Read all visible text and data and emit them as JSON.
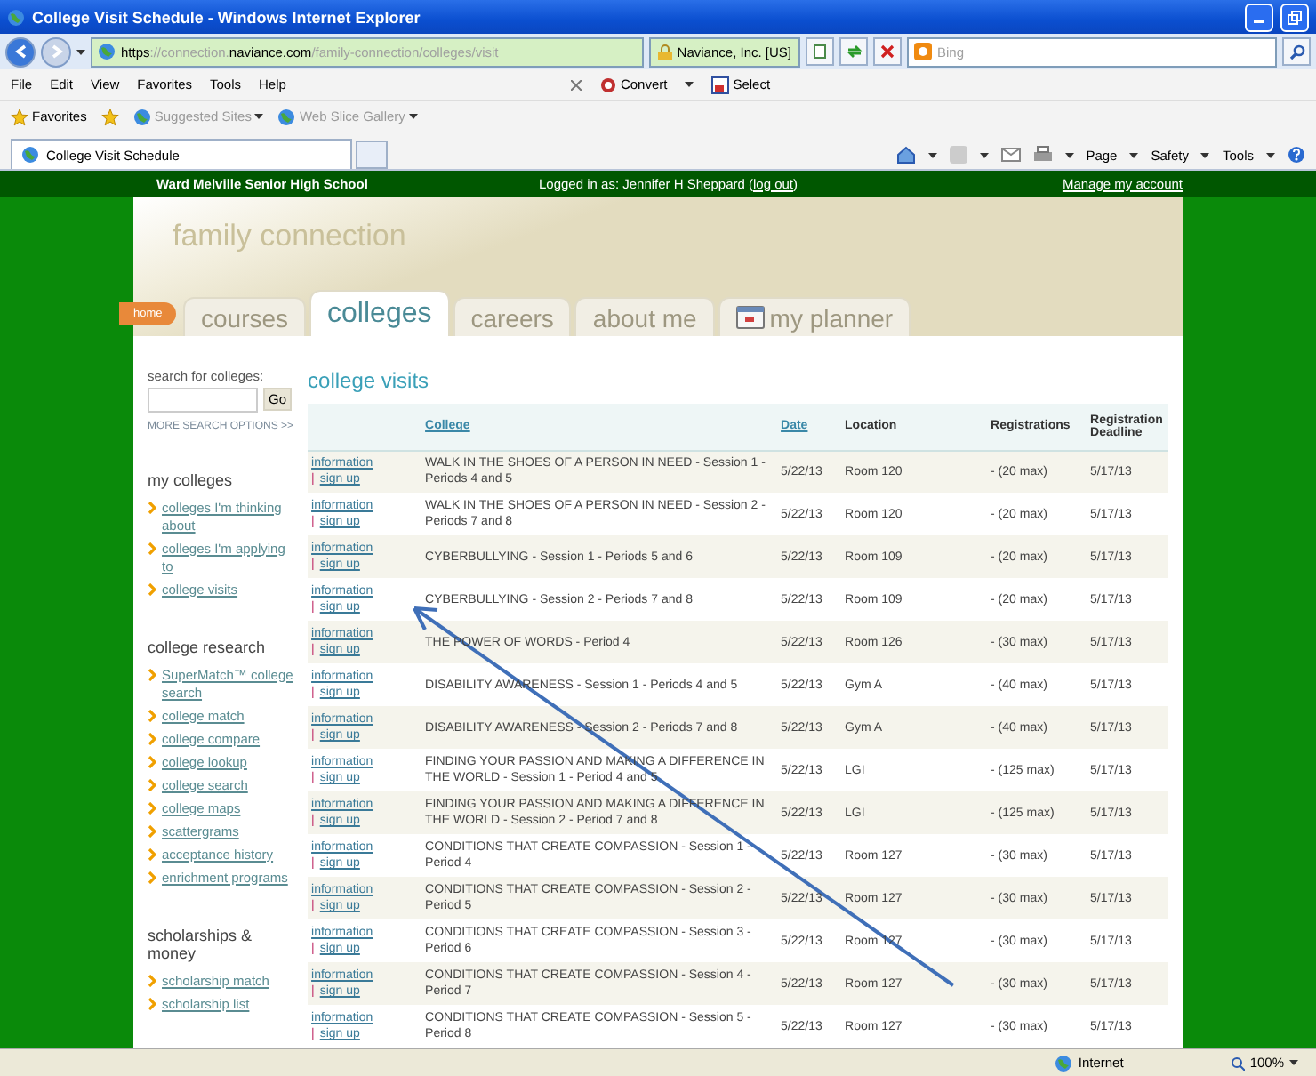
{
  "browser": {
    "title": "College Visit Schedule - Windows Internet Explorer",
    "address": {
      "scheme": "https",
      "sep": "://",
      "host_pre": "connection.",
      "host": "naviance.com",
      "path": "/family-connection/colleges/visit"
    },
    "security": "Naviance, Inc. [US]",
    "search": {
      "placeholder": "Bing"
    },
    "menu": [
      "File",
      "Edit",
      "View",
      "Favorites",
      "Tools",
      "Help"
    ],
    "toolbar": [
      "Convert",
      "Select"
    ],
    "favorites": {
      "label": "Favorites",
      "links": [
        {
          "label": "Suggested Sites",
          "disabled": true
        },
        {
          "label": "Web Slice Gallery",
          "disabled": true
        }
      ]
    },
    "tabs": [
      {
        "label": "College Visit Schedule",
        "selected": true
      }
    ],
    "commands": [
      "Page",
      "Safety",
      "Tools"
    ],
    "status": "Internet",
    "zoom": "100%"
  },
  "site": {
    "school": "Ward Melville Senior High School",
    "login": "Logged in as: Jennifer H Sheppard (",
    "logout": "log out",
    "login_end": ")",
    "manage": "Manage my account",
    "brand": "family connection",
    "home": "home",
    "tabs": [
      {
        "label": "courses",
        "selected": false,
        "kind": "text"
      },
      {
        "label": "colleges",
        "selected": true,
        "kind": "text"
      },
      {
        "label": "careers",
        "selected": false,
        "kind": "text"
      },
      {
        "label": "about me",
        "selected": false,
        "kind": "text"
      },
      {
        "label": "my planner",
        "selected": false,
        "kind": "planner"
      }
    ],
    "search": {
      "label": "search for colleges:",
      "button": "Go",
      "more": "MORE SEARCH OPTIONS >>"
    },
    "sections": [
      {
        "title": "my colleges",
        "links": [
          "colleges I'm thinking about",
          "colleges I'm applying to",
          "college visits"
        ]
      },
      {
        "title": "college research",
        "links": [
          "SuperMatch™ college search",
          "college match",
          "college compare",
          "college lookup",
          "college search",
          "college maps",
          "scattergrams",
          "acceptance history",
          "enrichment programs"
        ]
      },
      {
        "title": "scholarships & money",
        "links": [
          "scholarship match",
          "scholarship list"
        ]
      }
    ],
    "page_title": "college visits",
    "columns": [
      {
        "label": "College",
        "link": true
      },
      {
        "label": "Date",
        "link": true
      },
      {
        "label": "Location",
        "link": false
      },
      {
        "label": "Registrations",
        "link": false
      },
      {
        "label": "Registration Deadline",
        "link": false
      }
    ],
    "rows": [
      {
        "info": "information",
        "separator": "|",
        "signup": "sign up",
        "college": "WALK IN THE SHOES OF A PERSON IN NEED - Session 1 - Periods 4 and 5",
        "date": "5/22/13",
        "location": "Room 120",
        "registrations": "- (20 max)",
        "deadline": "5/17/13"
      },
      {
        "info": "information",
        "separator": "|",
        "signup": "sign up",
        "college": "WALK IN THE SHOES OF A PERSON IN NEED - Session 2 - Periods 7 and 8",
        "date": "5/22/13",
        "location": "Room 120",
        "registrations": "- (20 max)",
        "deadline": "5/17/13"
      },
      {
        "info": "information",
        "separator": "|",
        "signup": "sign up",
        "college": "CYBERBULLYING - Session 1 - Periods 5 and 6",
        "date": "5/22/13",
        "location": "Room 109",
        "registrations": "- (20 max)",
        "deadline": "5/17/13"
      },
      {
        "info": "information",
        "separator": "|",
        "signup": "sign up",
        "college": "CYBERBULLYING - Session 2 - Periods 7 and 8",
        "date": "5/22/13",
        "location": "Room 109",
        "registrations": "- (20 max)",
        "deadline": "5/17/13"
      },
      {
        "info": "information",
        "separator": "|",
        "signup": "sign up",
        "college": "THE POWER OF WORDS - Period 4",
        "date": "5/22/13",
        "location": "Room 126",
        "registrations": "- (30 max)",
        "deadline": "5/17/13"
      },
      {
        "info": "information",
        "separator": "|",
        "signup": "sign up",
        "college": "DISABILITY AWARENESS - Session 1 - Periods 4 and 5",
        "date": "5/22/13",
        "location": "Gym A",
        "registrations": "- (40 max)",
        "deadline": "5/17/13"
      },
      {
        "info": "information",
        "separator": "|",
        "signup": "sign up",
        "college": "DISABILITY AWARENESS - Session 2 - Periods 7 and 8",
        "date": "5/22/13",
        "location": "Gym A",
        "registrations": "- (40 max)",
        "deadline": "5/17/13"
      },
      {
        "info": "information",
        "separator": "|",
        "signup": "sign up",
        "college": "FINDING YOUR PASSION AND MAKING A DIFFERENCE IN THE WORLD - Session 1 - Period 4 and 5",
        "date": "5/22/13",
        "location": "LGI",
        "registrations": "- (125 max)",
        "deadline": "5/17/13"
      },
      {
        "info": "information",
        "separator": "|",
        "signup": "sign up",
        "college": "FINDING YOUR PASSION AND MAKING A DIFFERENCE IN THE WORLD - Session 2 - Period 7 and 8",
        "date": "5/22/13",
        "location": "LGI",
        "registrations": "- (125 max)",
        "deadline": "5/17/13"
      },
      {
        "info": "information",
        "separator": "|",
        "signup": "sign up",
        "college": "CONDITIONS THAT CREATE COMPASSION - Session 1 - Period 4",
        "date": "5/22/13",
        "location": "Room 127",
        "registrations": "- (30 max)",
        "deadline": "5/17/13"
      },
      {
        "info": "information",
        "separator": "|",
        "signup": "sign up",
        "college": "CONDITIONS THAT CREATE COMPASSION - Session 2 - Period 5",
        "date": "5/22/13",
        "location": "Room 127",
        "registrations": "- (30 max)",
        "deadline": "5/17/13"
      },
      {
        "info": "information",
        "separator": "|",
        "signup": "sign up",
        "college": "CONDITIONS THAT CREATE COMPASSION - Session 3 - Period 6",
        "date": "5/22/13",
        "location": "Room 127",
        "registrations": "- (30 max)",
        "deadline": "5/17/13"
      },
      {
        "info": "information",
        "separator": "|",
        "signup": "sign up",
        "college": "CONDITIONS THAT CREATE COMPASSION - Session 4 - Period 7",
        "date": "5/22/13",
        "location": "Room 127",
        "registrations": "- (30 max)",
        "deadline": "5/17/13"
      },
      {
        "info": "information",
        "separator": "|",
        "signup": "sign up",
        "college": "CONDITIONS THAT CREATE COMPASSION - Session 5 - Period 8",
        "date": "5/22/13",
        "location": "Room 127",
        "registrations": "- (30 max)",
        "deadline": "5/17/13"
      }
    ]
  }
}
